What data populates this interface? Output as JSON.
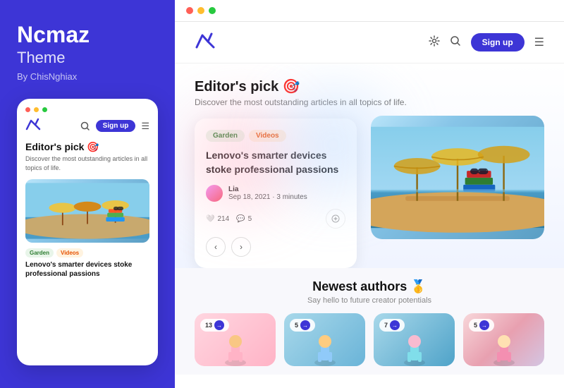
{
  "sidebar": {
    "title": "Ncmaz",
    "subtitle": "Theme",
    "by": "By ChisNghiax"
  },
  "phone_mockup": {
    "nav": {
      "signup_label": "Sign up"
    },
    "heading": "Editor's pick",
    "heading_emoji": "🎯",
    "subtext": "Discover the most outstanding articles in all topics of life.",
    "tags": [
      "Garden",
      "Videos"
    ],
    "article_title": "Lenovo's smarter devices stoke professional passions"
  },
  "browser": {
    "dots": [
      "red",
      "yellow",
      "green"
    ]
  },
  "site": {
    "nav": {
      "signup_label": "Sign up"
    },
    "editors": {
      "title": "Editor's pick",
      "emoji": "🎯",
      "desc": "Discover the most outstanding articles in all topics of life."
    },
    "article_card": {
      "tags": [
        "Garden",
        "Videos"
      ],
      "title": "Lenovo's smarter devices stoke professional passions",
      "author_name": "Lia",
      "author_date": "Sep 18, 2021 · 3 minutes",
      "likes": "214",
      "comments": "5"
    },
    "newest": {
      "title": "Newest authors",
      "emoji": "🥇",
      "desc": "Say hello to future creator potentials",
      "cards": [
        {
          "badge": "13"
        },
        {
          "badge": "5"
        },
        {
          "badge": "7"
        },
        {
          "badge": "5"
        }
      ]
    }
  }
}
